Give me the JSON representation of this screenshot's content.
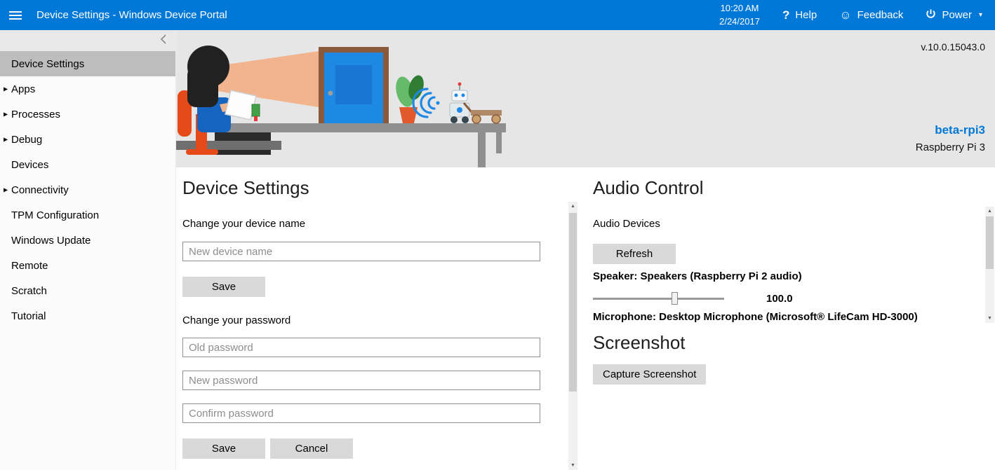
{
  "topbar": {
    "title": "Device Settings - Windows Device Portal",
    "time": "10:20 AM",
    "date": "2/24/2017",
    "help": "Help",
    "feedback": "Feedback",
    "power": "Power"
  },
  "icons": {
    "expand_arrow": "▶",
    "help": "?",
    "feedback": "☺",
    "power_caret": "▾",
    "scroll_up": "▲",
    "scroll_down": "▼"
  },
  "sidebar": {
    "items": [
      {
        "label": "Device Settings"
      },
      {
        "label": "Apps"
      },
      {
        "label": "Processes"
      },
      {
        "label": "Debug"
      },
      {
        "label": "Devices"
      },
      {
        "label": "Connectivity"
      },
      {
        "label": "TPM Configuration"
      },
      {
        "label": "Windows Update"
      },
      {
        "label": "Remote"
      },
      {
        "label": "Scratch"
      },
      {
        "label": "Tutorial"
      }
    ]
  },
  "banner": {
    "version": "v.10.0.15043.0",
    "device_name": "beta-rpi3",
    "device_model": "Raspberry Pi 3"
  },
  "device_settings": {
    "heading": "Device Settings",
    "change_name_label": "Change your device name",
    "new_device_name_placeholder": "New device name",
    "save": "Save",
    "change_password_label": "Change your password",
    "old_password_placeholder": "Old password",
    "new_password_placeholder": "New password",
    "confirm_password_placeholder": "Confirm password",
    "cancel": "Cancel"
  },
  "audio": {
    "heading": "Audio Control",
    "devices_label": "Audio Devices",
    "refresh": "Refresh",
    "speaker_label": "Speaker: Speakers (Raspberry Pi 2 audio)",
    "speaker_volume": "100.0",
    "microphone_label": "Microphone: Desktop Microphone (Microsoft® LifeCam HD-3000)"
  },
  "screenshot": {
    "heading": "Screenshot",
    "capture": "Capture Screenshot"
  },
  "colors": {
    "accent": "#0078d7",
    "banner_bg": "#e6e6e6",
    "sidebar_selected_bg": "#bdbdbd",
    "button_bg": "#d9d9d9"
  }
}
